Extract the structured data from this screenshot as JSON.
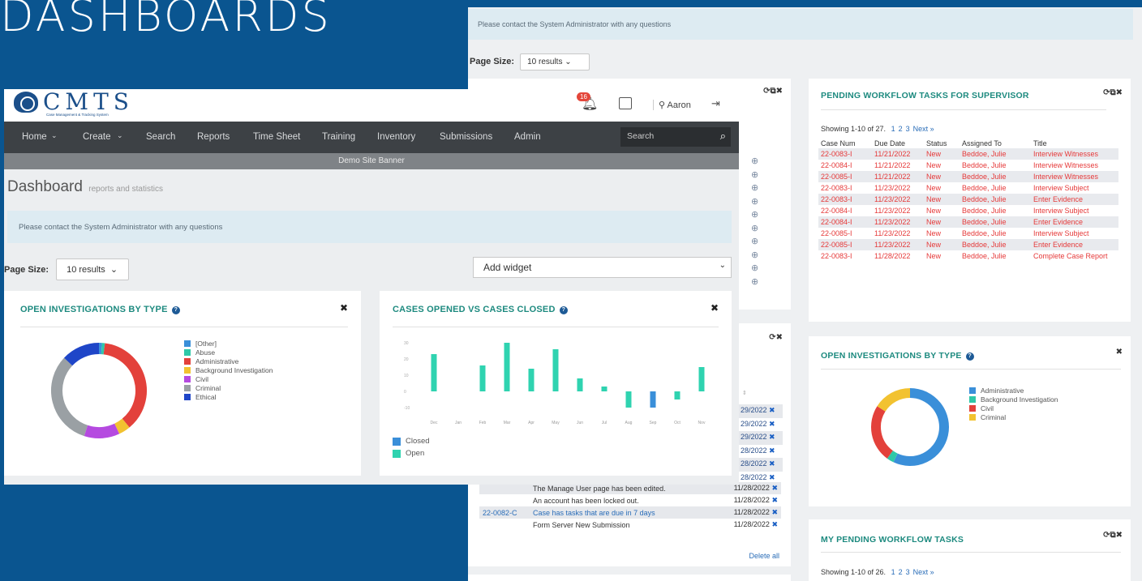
{
  "headline": "DASHBOARDS",
  "colors": {
    "teal_title": "#1d8a7f",
    "red_rows": "#e63a3a",
    "nav_bg": "#3d4145",
    "banner_bg": "#7f8387",
    "info_bg": "#ddebf2",
    "bg": "#0a5590"
  },
  "back_screen": {
    "info_message": "Please contact the System Administrator with any questions",
    "page_size_label": "Page Size:",
    "page_size_value": "10 results",
    "pending_supervisor": {
      "title": "PENDING WORKFLOW TASKS FOR SUPERVISOR",
      "showing": "Showing 1-10 of 27.",
      "pages": [
        "1",
        "2",
        "3",
        "Next »"
      ],
      "columns": [
        "Case Num",
        "Due Date",
        "Status",
        "Assigned To",
        "Title"
      ],
      "rows": [
        [
          "22-0083-I",
          "11/21/2022",
          "New",
          "Beddoe, Julie",
          "Interview Witnesses"
        ],
        [
          "22-0084-I",
          "11/21/2022",
          "New",
          "Beddoe, Julie",
          "Interview Witnesses"
        ],
        [
          "22-0085-I",
          "11/21/2022",
          "New",
          "Beddoe, Julie",
          "Interview Witnesses"
        ],
        [
          "22-0083-I",
          "11/23/2022",
          "New",
          "Beddoe, Julie",
          "Interview Subject"
        ],
        [
          "22-0083-I",
          "11/23/2022",
          "New",
          "Beddoe, Julie",
          "Enter Evidence"
        ],
        [
          "22-0084-I",
          "11/23/2022",
          "New",
          "Beddoe, Julie",
          "Interview Subject"
        ],
        [
          "22-0084-I",
          "11/23/2022",
          "New",
          "Beddoe, Julie",
          "Enter Evidence"
        ],
        [
          "22-0085-I",
          "11/23/2022",
          "New",
          "Beddoe, Julie",
          "Interview Subject"
        ],
        [
          "22-0085-I",
          "11/23/2022",
          "New",
          "Beddoe, Julie",
          "Enter Evidence"
        ],
        [
          "22-0083-I",
          "11/28/2022",
          "New",
          "Beddoe, Julie",
          "Complete Case Report"
        ]
      ]
    },
    "open_investigations": {
      "title": "OPEN INVESTIGATIONS BY TYPE",
      "legend": [
        {
          "label": "Administrative",
          "color": "#3a8fd9"
        },
        {
          "label": "Background Investigation",
          "color": "#2fc8a8"
        },
        {
          "label": "Civil",
          "color": "#e3413b"
        },
        {
          "label": "Criminal",
          "color": "#f2c230"
        }
      ]
    },
    "my_pending": {
      "title": "MY PENDING WORKFLOW TASKS",
      "showing": "Showing 1-10 of 26.",
      "pages": [
        "1",
        "2",
        "3",
        "Next »"
      ]
    },
    "notifications": {
      "date_header": "te",
      "partial_dates": [
        "29/2022",
        "29/2022",
        "29/2022",
        "28/2022",
        "28/2022",
        "28/2022"
      ],
      "rows": [
        {
          "case": "",
          "message": "The Manage User page has been edited.",
          "date": "11/28/2022"
        },
        {
          "case": "",
          "message": "An account has been locked out.",
          "date": "11/28/2022"
        },
        {
          "case": "22-0082-C",
          "message": "Case has tasks that are due in 7 days",
          "date": "11/28/2022"
        },
        {
          "case": "",
          "message": "Form Server New Submission",
          "date": "11/28/2022"
        }
      ],
      "delete_all": "Delete all"
    }
  },
  "front_app": {
    "logo_text": "CMTS",
    "logo_subtitle": "Case Management & Tracking System",
    "notification_count": "16",
    "user_name": "Aaron",
    "nav": [
      "Home",
      "Create",
      "Search",
      "Reports",
      "Time Sheet",
      "Training",
      "Inventory",
      "Submissions",
      "Admin"
    ],
    "search_placeholder": "Search",
    "banner": "Demo Site Banner",
    "dashboard_title": "Dashboard",
    "dashboard_subtitle": "reports and statistics",
    "info_message": "Please contact the System Administrator with any questions",
    "page_size_label": "Page Size:",
    "page_size_value": "10 results",
    "add_widget": "Add widget",
    "open_investigations": {
      "title": "OPEN INVESTIGATIONS BY TYPE",
      "legend": [
        {
          "label": "[Other]",
          "color": "#3a8fd9"
        },
        {
          "label": "Abuse",
          "color": "#2fc8a8"
        },
        {
          "label": "Administrative",
          "color": "#e3413b"
        },
        {
          "label": "Background Investigation",
          "color": "#f2c230"
        },
        {
          "label": "Civil",
          "color": "#b54ae0"
        },
        {
          "label": "Criminal",
          "color": "#9aa0a4"
        },
        {
          "label": "Ethical",
          "color": "#1f46c8"
        }
      ]
    },
    "cases_chart": {
      "title": "CASES OPENED VS CASES CLOSED",
      "legend": [
        {
          "label": "Closed",
          "color": "#3a8fd9"
        },
        {
          "label": "Open",
          "color": "#2fd3b0"
        }
      ]
    }
  },
  "chart_data": [
    {
      "type": "pie",
      "title": "OPEN INVESTIGATIONS BY TYPE",
      "labels": [
        "[Other]",
        "Abuse",
        "Administrative",
        "Background Investigation",
        "Civil",
        "Criminal",
        "Ethical"
      ],
      "values": [
        1,
        1,
        37,
        4,
        12,
        32,
        13
      ]
    },
    {
      "type": "pie",
      "title": "OPEN INVESTIGATIONS BY TYPE",
      "labels": [
        "Administrative",
        "Background Investigation",
        "Civil",
        "Criminal"
      ],
      "values": [
        57,
        3,
        24,
        16
      ]
    },
    {
      "type": "bar",
      "title": "CASES OPENED VS CASES CLOSED",
      "categories": [
        "Dec",
        "Jan",
        "Feb",
        "Mar",
        "Apr",
        "May",
        "Jun",
        "Jul",
        "Aug",
        "Sep",
        "Oct",
        "Nov"
      ],
      "ytick_labels": [
        "30",
        "20",
        "10",
        "0",
        "-10"
      ],
      "series": [
        {
          "name": "Closed",
          "values": [
            0,
            0,
            0,
            0,
            0,
            0,
            0,
            0,
            0,
            -10,
            0,
            0
          ]
        },
        {
          "name": "Open",
          "values": [
            23,
            0,
            16,
            30,
            14,
            26,
            8,
            3,
            -10,
            0,
            -5,
            15
          ]
        }
      ],
      "ylim": [
        -10,
        30
      ]
    }
  ]
}
